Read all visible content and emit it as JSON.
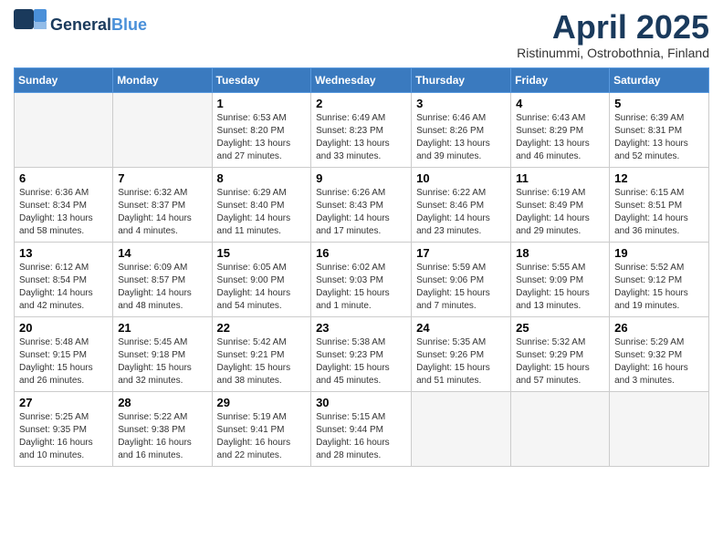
{
  "header": {
    "logo_line1": "General",
    "logo_line2": "Blue",
    "title": "April 2025",
    "subtitle": "Ristinummi, Ostrobothnia, Finland"
  },
  "days_of_week": [
    "Sunday",
    "Monday",
    "Tuesday",
    "Wednesday",
    "Thursday",
    "Friday",
    "Saturday"
  ],
  "weeks": [
    [
      {
        "day": "",
        "detail": ""
      },
      {
        "day": "",
        "detail": ""
      },
      {
        "day": "1",
        "detail": "Sunrise: 6:53 AM\nSunset: 8:20 PM\nDaylight: 13 hours and 27 minutes."
      },
      {
        "day": "2",
        "detail": "Sunrise: 6:49 AM\nSunset: 8:23 PM\nDaylight: 13 hours and 33 minutes."
      },
      {
        "day": "3",
        "detail": "Sunrise: 6:46 AM\nSunset: 8:26 PM\nDaylight: 13 hours and 39 minutes."
      },
      {
        "day": "4",
        "detail": "Sunrise: 6:43 AM\nSunset: 8:29 PM\nDaylight: 13 hours and 46 minutes."
      },
      {
        "day": "5",
        "detail": "Sunrise: 6:39 AM\nSunset: 8:31 PM\nDaylight: 13 hours and 52 minutes."
      }
    ],
    [
      {
        "day": "6",
        "detail": "Sunrise: 6:36 AM\nSunset: 8:34 PM\nDaylight: 13 hours and 58 minutes."
      },
      {
        "day": "7",
        "detail": "Sunrise: 6:32 AM\nSunset: 8:37 PM\nDaylight: 14 hours and 4 minutes."
      },
      {
        "day": "8",
        "detail": "Sunrise: 6:29 AM\nSunset: 8:40 PM\nDaylight: 14 hours and 11 minutes."
      },
      {
        "day": "9",
        "detail": "Sunrise: 6:26 AM\nSunset: 8:43 PM\nDaylight: 14 hours and 17 minutes."
      },
      {
        "day": "10",
        "detail": "Sunrise: 6:22 AM\nSunset: 8:46 PM\nDaylight: 14 hours and 23 minutes."
      },
      {
        "day": "11",
        "detail": "Sunrise: 6:19 AM\nSunset: 8:49 PM\nDaylight: 14 hours and 29 minutes."
      },
      {
        "day": "12",
        "detail": "Sunrise: 6:15 AM\nSunset: 8:51 PM\nDaylight: 14 hours and 36 minutes."
      }
    ],
    [
      {
        "day": "13",
        "detail": "Sunrise: 6:12 AM\nSunset: 8:54 PM\nDaylight: 14 hours and 42 minutes."
      },
      {
        "day": "14",
        "detail": "Sunrise: 6:09 AM\nSunset: 8:57 PM\nDaylight: 14 hours and 48 minutes."
      },
      {
        "day": "15",
        "detail": "Sunrise: 6:05 AM\nSunset: 9:00 PM\nDaylight: 14 hours and 54 minutes."
      },
      {
        "day": "16",
        "detail": "Sunrise: 6:02 AM\nSunset: 9:03 PM\nDaylight: 15 hours and 1 minute."
      },
      {
        "day": "17",
        "detail": "Sunrise: 5:59 AM\nSunset: 9:06 PM\nDaylight: 15 hours and 7 minutes."
      },
      {
        "day": "18",
        "detail": "Sunrise: 5:55 AM\nSunset: 9:09 PM\nDaylight: 15 hours and 13 minutes."
      },
      {
        "day": "19",
        "detail": "Sunrise: 5:52 AM\nSunset: 9:12 PM\nDaylight: 15 hours and 19 minutes."
      }
    ],
    [
      {
        "day": "20",
        "detail": "Sunrise: 5:48 AM\nSunset: 9:15 PM\nDaylight: 15 hours and 26 minutes."
      },
      {
        "day": "21",
        "detail": "Sunrise: 5:45 AM\nSunset: 9:18 PM\nDaylight: 15 hours and 32 minutes."
      },
      {
        "day": "22",
        "detail": "Sunrise: 5:42 AM\nSunset: 9:21 PM\nDaylight: 15 hours and 38 minutes."
      },
      {
        "day": "23",
        "detail": "Sunrise: 5:38 AM\nSunset: 9:23 PM\nDaylight: 15 hours and 45 minutes."
      },
      {
        "day": "24",
        "detail": "Sunrise: 5:35 AM\nSunset: 9:26 PM\nDaylight: 15 hours and 51 minutes."
      },
      {
        "day": "25",
        "detail": "Sunrise: 5:32 AM\nSunset: 9:29 PM\nDaylight: 15 hours and 57 minutes."
      },
      {
        "day": "26",
        "detail": "Sunrise: 5:29 AM\nSunset: 9:32 PM\nDaylight: 16 hours and 3 minutes."
      }
    ],
    [
      {
        "day": "27",
        "detail": "Sunrise: 5:25 AM\nSunset: 9:35 PM\nDaylight: 16 hours and 10 minutes."
      },
      {
        "day": "28",
        "detail": "Sunrise: 5:22 AM\nSunset: 9:38 PM\nDaylight: 16 hours and 16 minutes."
      },
      {
        "day": "29",
        "detail": "Sunrise: 5:19 AM\nSunset: 9:41 PM\nDaylight: 16 hours and 22 minutes."
      },
      {
        "day": "30",
        "detail": "Sunrise: 5:15 AM\nSunset: 9:44 PM\nDaylight: 16 hours and 28 minutes."
      },
      {
        "day": "",
        "detail": ""
      },
      {
        "day": "",
        "detail": ""
      },
      {
        "day": "",
        "detail": ""
      }
    ]
  ]
}
